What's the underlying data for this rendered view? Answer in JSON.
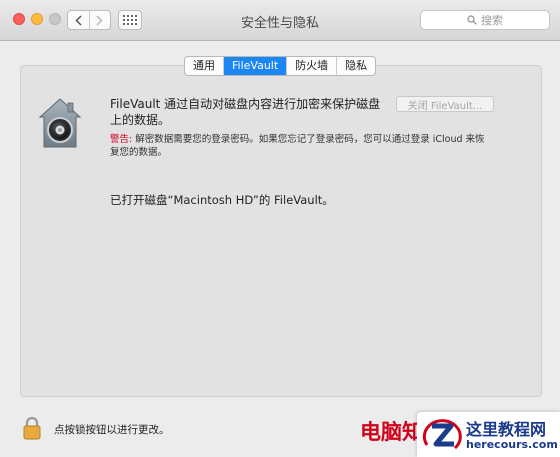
{
  "window": {
    "title": "安全性与隐私",
    "nav_back_icon": "chevron-left-icon",
    "nav_forward_icon": "chevron-right-icon",
    "show_all_icon": "grid-icon"
  },
  "search": {
    "placeholder": "搜索",
    "icon": "search-icon"
  },
  "tabs": [
    {
      "label": "通用",
      "active": false
    },
    {
      "label": "FileVault",
      "active": true
    },
    {
      "label": "防火墙",
      "active": false
    },
    {
      "label": "隐私",
      "active": false
    }
  ],
  "filevault": {
    "icon": "filevault-house-icon",
    "description": "FileVault 通过自动对磁盘内容进行加密来保护磁盘上的数据。",
    "turn_off_button": "关闭 FileVault...",
    "turn_off_enabled": false,
    "warning_label": "警告:",
    "warning_text": "解密数据需要您的登录密码。如果您忘记了登录密码，您可以通过登录 iCloud 来恢复您的数据。",
    "status": "已打开磁盘“Macintosh HD”的 FileVault。"
  },
  "footer": {
    "lock_icon": "lock-icon",
    "lock_text": "点按锁按钮以进行更改。"
  },
  "watermark": {
    "text": "电脑知",
    "logo_icon": "z-logo-icon",
    "site_name": "这里教程网",
    "url": "herecours.com"
  },
  "colors": {
    "accent_tab": "#1d86f5",
    "warning_red": "#d0021b",
    "close_light": "#fc605c",
    "minimize_light": "#fdbc40",
    "watermark_blue": "#1a3a8c"
  }
}
